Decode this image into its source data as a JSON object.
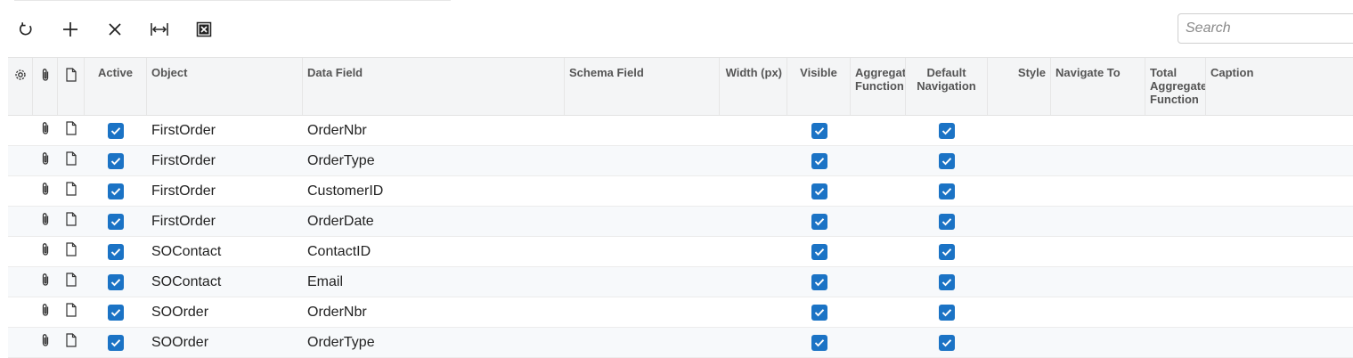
{
  "toolbar": {
    "buttons": [
      {
        "name": "refresh-button",
        "icon": "refresh-icon"
      },
      {
        "name": "add-row-button",
        "icon": "plus-icon"
      },
      {
        "name": "delete-row-button",
        "icon": "close-icon"
      },
      {
        "name": "fit-columns-button",
        "icon": "fit-width-icon"
      },
      {
        "name": "export-excel-button",
        "icon": "excel-icon"
      }
    ]
  },
  "search": {
    "placeholder": "Search"
  },
  "columns": {
    "active": "Active",
    "object": "Object",
    "data_field": "Data Field",
    "schema_field": "Schema Field",
    "width": "Width (px)",
    "visible": "Visible",
    "aggregate": "Aggregate Function",
    "default_nav": "Default Navigation",
    "style": "Style",
    "navigate_to": "Navigate To",
    "total_aggregate": "Total Aggregate Function",
    "caption": "Caption"
  },
  "rows": [
    {
      "active": true,
      "object": "FirstOrder",
      "data_field": "OrderNbr",
      "visible": true,
      "default_nav": true
    },
    {
      "active": true,
      "object": "FirstOrder",
      "data_field": "OrderType",
      "visible": true,
      "default_nav": true
    },
    {
      "active": true,
      "object": "FirstOrder",
      "data_field": "CustomerID",
      "visible": true,
      "default_nav": true
    },
    {
      "active": true,
      "object": "FirstOrder",
      "data_field": "OrderDate",
      "visible": true,
      "default_nav": true
    },
    {
      "active": true,
      "object": "SOContact",
      "data_field": "ContactID",
      "visible": true,
      "default_nav": true
    },
    {
      "active": true,
      "object": "SOContact",
      "data_field": "Email",
      "visible": true,
      "default_nav": true
    },
    {
      "active": true,
      "object": "SOOrder",
      "data_field": "OrderNbr",
      "visible": true,
      "default_nav": true
    },
    {
      "active": true,
      "object": "SOOrder",
      "data_field": "OrderType",
      "visible": true,
      "default_nav": true
    }
  ],
  "colors": {
    "checkbox": "#1b73c5",
    "header_bg": "#f4f5f6",
    "alt_row_bg": "#f7f9fb"
  }
}
